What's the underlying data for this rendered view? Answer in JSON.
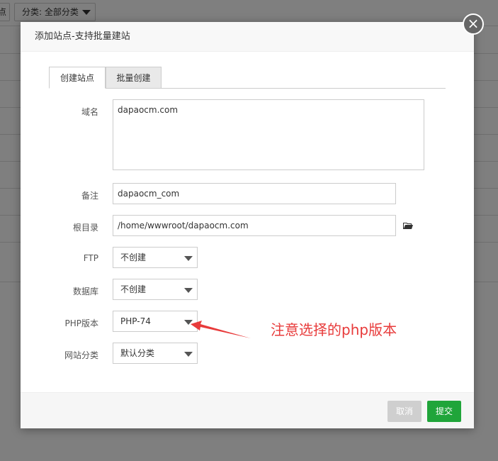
{
  "background": {
    "left_button_label": "点",
    "category_select": "分类: 全部分类"
  },
  "modal": {
    "title": "添加站点-支持批量建站",
    "close_label": "×",
    "tabs": [
      {
        "label": "创建站点",
        "active": true
      },
      {
        "label": "批量创建",
        "active": false
      }
    ],
    "fields": {
      "domain": {
        "label": "域名",
        "value": "dapaocm.com"
      },
      "remark": {
        "label": "备注",
        "value": "dapaocm_com"
      },
      "root_dir": {
        "label": "根目录",
        "value": "/home/wwwroot/dapaocm.com"
      },
      "ftp": {
        "label": "FTP",
        "value": "不创建"
      },
      "database": {
        "label": "数据库",
        "value": "不创建"
      },
      "php_version": {
        "label": "PHP版本",
        "value": "PHP-74"
      },
      "site_category": {
        "label": "网站分类",
        "value": "默认分类"
      }
    },
    "annotation": "注意选择的php版本",
    "footer": {
      "cancel_label": "取消",
      "submit_label": "提交"
    }
  },
  "colors": {
    "submit": "#20a53a",
    "cancel": "#cfcfcf",
    "annotation": "#e83b3b",
    "overlay": "rgba(0,0,0,0.5)"
  },
  "icons": [
    "folder-open-icon",
    "close-icon",
    "caret-down-icon",
    "red-arrow-icon"
  ]
}
